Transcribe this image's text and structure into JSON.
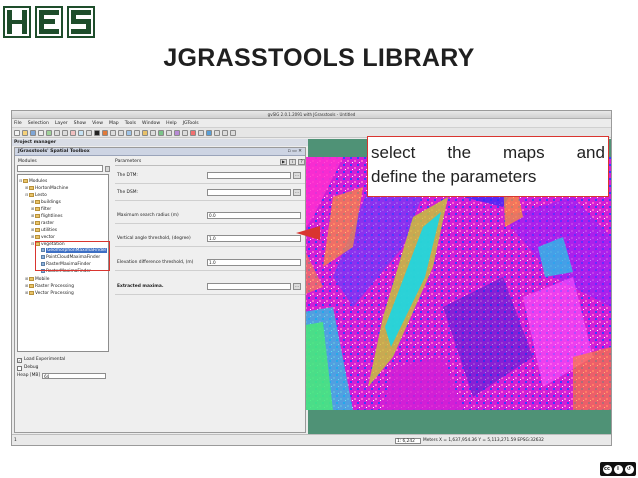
{
  "slide": {
    "title": "JGRASSTOOLS LIBRARY",
    "logo_text": "HES",
    "callout_line1_words": [
      "select",
      "the",
      "maps",
      "and"
    ],
    "callout_line2": "define the parameters"
  },
  "app": {
    "window_title": "gvSIG 2.0.1.2091 with JGrasstools - Untitled",
    "menu": [
      "File",
      "Selection",
      "Layer",
      "Show",
      "View",
      "Map",
      "Tools",
      "Window",
      "Help",
      "JGTools"
    ],
    "project_manager_title": "Project manager",
    "toolbox_title": "JGrasstools' Spatial Toolbox",
    "modules_label": "Modules",
    "parameters_label": "Parameters",
    "tree": [
      {
        "depth": 0,
        "expander": "⊟",
        "label": "Modules",
        "kind": "folder"
      },
      {
        "depth": 1,
        "expander": "⊞",
        "label": "HortonMachine",
        "kind": "folder"
      },
      {
        "depth": 1,
        "expander": "⊟",
        "label": "Lesto",
        "kind": "folder"
      },
      {
        "depth": 2,
        "expander": "⊞",
        "label": "buildings",
        "kind": "folder"
      },
      {
        "depth": 2,
        "expander": "⊞",
        "label": "filter",
        "kind": "folder"
      },
      {
        "depth": 2,
        "expander": "⊞",
        "label": "flightlines",
        "kind": "folder"
      },
      {
        "depth": 2,
        "expander": "⊞",
        "label": "raster",
        "kind": "folder"
      },
      {
        "depth": 2,
        "expander": "⊞",
        "label": "utilities",
        "kind": "folder"
      },
      {
        "depth": 2,
        "expander": "⊞",
        "label": "vector",
        "kind": "folder"
      },
      {
        "depth": 2,
        "expander": "⊟",
        "label": "vegetation",
        "kind": "folder"
      },
      {
        "depth": 3,
        "expander": "",
        "label": "GeomorphonMaximaFinder",
        "kind": "leaf",
        "selected": true
      },
      {
        "depth": 3,
        "expander": "",
        "label": "PointCloudMaximaFinder",
        "kind": "leaf"
      },
      {
        "depth": 3,
        "expander": "",
        "label": "RasterMaximaFinder",
        "kind": "leaf"
      },
      {
        "depth": 3,
        "expander": "",
        "label": "RasterMaximaFinder",
        "kind": "leaf"
      },
      {
        "depth": 1,
        "expander": "⊞",
        "label": "Mobile",
        "kind": "folder"
      },
      {
        "depth": 1,
        "expander": "⊞",
        "label": "Raster Processing",
        "kind": "folder"
      },
      {
        "depth": 1,
        "expander": "⊞",
        "label": "Vector Processing",
        "kind": "folder"
      }
    ],
    "load_experimental_label": "Load Experimental",
    "debug_label": "Debug",
    "heap_label": "Heap [MB]",
    "heap_value": "64",
    "parameters": [
      {
        "label": "The DTM:",
        "value": "",
        "browse": true,
        "bold": false
      },
      {
        "label": "The DSM:",
        "value": "",
        "browse": true,
        "bold": false
      },
      {
        "label": "Maximum search radius (m)",
        "value": "0.0",
        "browse": false,
        "bold": false
      },
      {
        "label": "Vertical angle threshold, (degree)",
        "value": "1.0",
        "browse": false,
        "bold": false
      },
      {
        "label": "Elevation difference threshold, (m)",
        "value": "1.0",
        "browse": false,
        "bold": false
      },
      {
        "label": "Extracted maxima.",
        "value": "",
        "browse": true,
        "bold": true
      }
    ],
    "status": {
      "left": "1",
      "scale": "1: 6,242",
      "coords": "Meters X = 1,637,954.36 Y = 5,113,271.59 EPSG:32632"
    }
  },
  "colors": {
    "map_background": "#4f9276",
    "highlight": "#d9352f",
    "selection": "#3d6fc4"
  }
}
